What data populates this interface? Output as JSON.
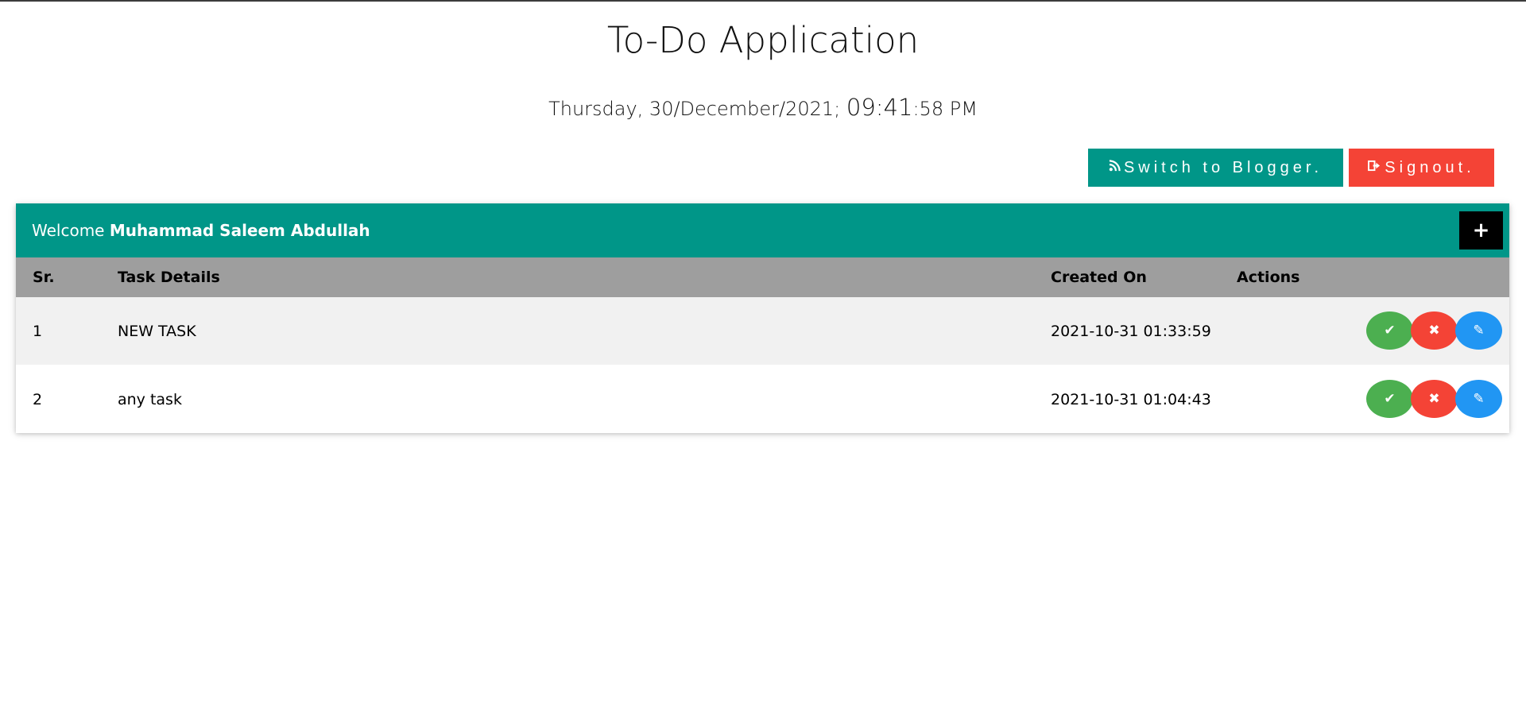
{
  "header": {
    "title": "To-Do Application",
    "date_text": "Thursday, 30/December/2021; ",
    "time_hm": "09:41",
    "time_rest": ":58 PM"
  },
  "toolbar": {
    "blogger_label": "Switch to Blogger.",
    "blogger_icon": "rss-icon",
    "signout_label": "Signout.",
    "signout_icon": "sign-out-icon"
  },
  "card": {
    "welcome_prefix": "Welcome ",
    "user_name": "Muhammad Saleem Abdullah",
    "add_icon": "+"
  },
  "table": {
    "columns": [
      "Sr.",
      "Task Details",
      "Created On",
      "Actions"
    ],
    "rows": [
      {
        "sr": "1",
        "task": "NEW TASK",
        "created": "2021-10-31 01:33:59"
      },
      {
        "sr": "2",
        "task": "any task",
        "created": "2021-10-31 01:04:43"
      }
    ]
  },
  "icons": {
    "done": "✔",
    "delete": "✖",
    "edit": "✎"
  },
  "colors": {
    "teal": "#009688",
    "red": "#f44336",
    "green": "#4caf50",
    "blue": "#2196f3",
    "header_gray": "#9e9e9e",
    "row_stripe": "#f1f1f1"
  }
}
